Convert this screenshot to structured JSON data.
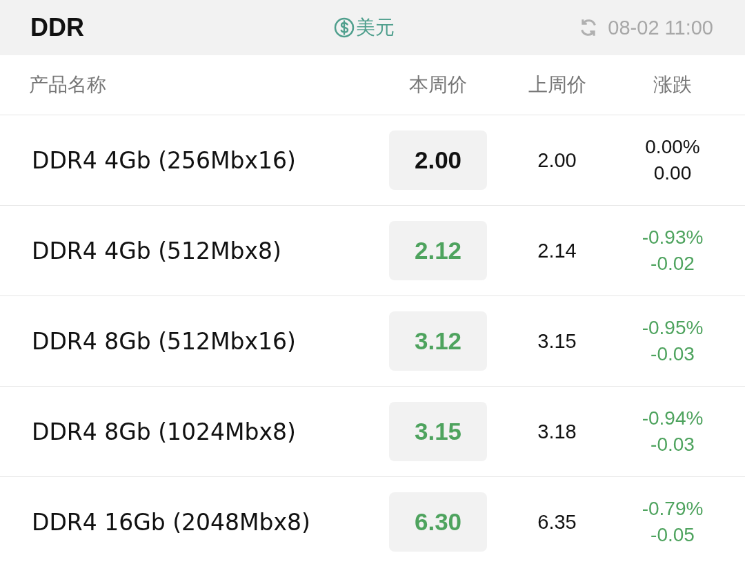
{
  "header": {
    "title": "DDR",
    "currency": "美元",
    "updated": "08-02 11:00"
  },
  "columns": [
    "产品名称",
    "本周价",
    "上周价",
    "涨跌"
  ],
  "rows": [
    {
      "name": "DDR4 4Gb (256Mbx16)",
      "price": "2.00",
      "last_price": "2.00",
      "change_pct": "0.00%",
      "change": "0.00",
      "kind": "flat"
    },
    {
      "name": "DDR4 4Gb (512Mbx8)",
      "price": "2.12",
      "last_price": "2.14",
      "change_pct": "-0.93%",
      "change": "-0.02",
      "kind": "down"
    },
    {
      "name": "DDR4 8Gb (512Mbx16)",
      "price": "3.12",
      "last_price": "3.15",
      "change_pct": "-0.95%",
      "change": "-0.03",
      "kind": "down"
    },
    {
      "name": "DDR4 8Gb (1024Mbx8)",
      "price": "3.15",
      "last_price": "3.18",
      "change_pct": "-0.94%",
      "change": "-0.03",
      "kind": "down"
    },
    {
      "name": "DDR4 16Gb (2048Mbx8)",
      "price": "6.30",
      "last_price": "6.35",
      "change_pct": "-0.79%",
      "change": "-0.05",
      "kind": "down"
    }
  ]
}
